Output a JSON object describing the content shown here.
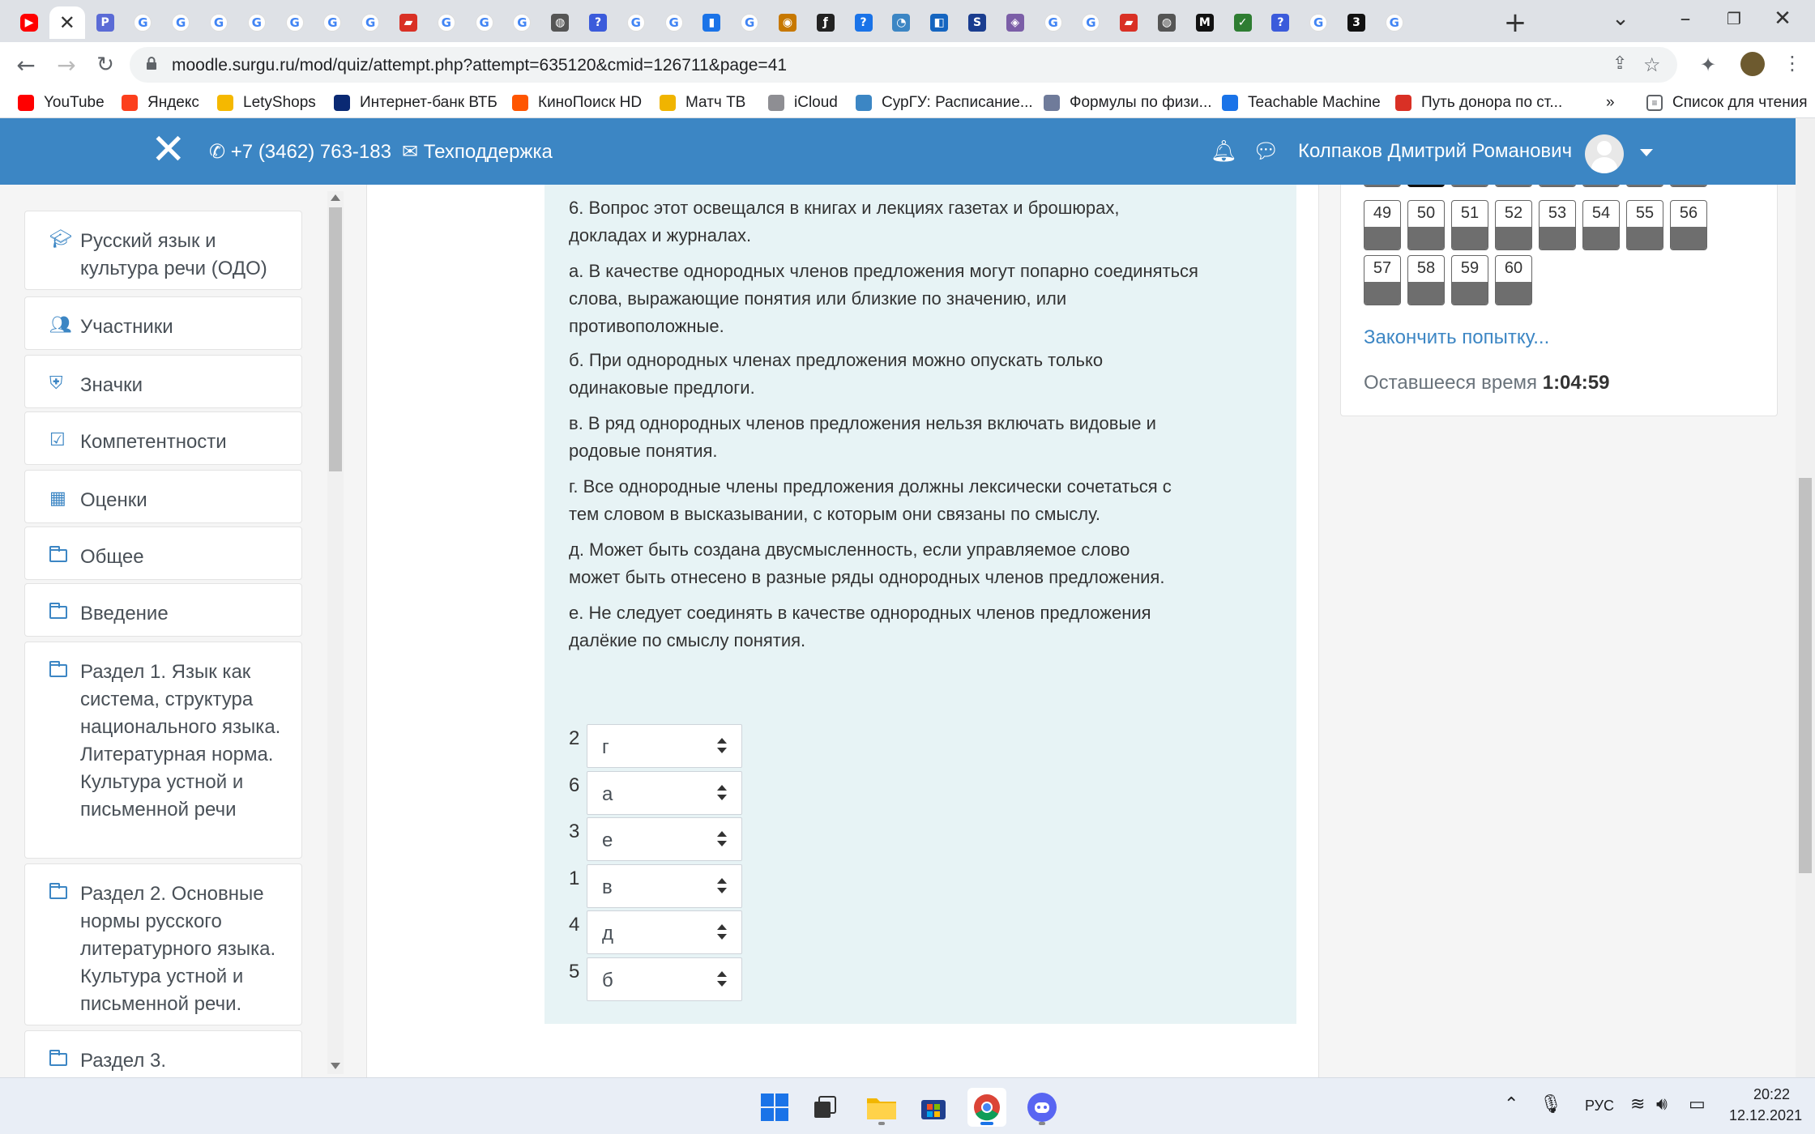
{
  "browser": {
    "url": "moodle.surgu.ru/mod/quiz/attempt.php?attempt=635120&cmid=126711&page=41",
    "bookmarks": [
      {
        "label": "YouTube",
        "color": "#ff0000"
      },
      {
        "label": "Яндекс",
        "color": "#fc3f1d"
      },
      {
        "label": "LetyShops",
        "color": "#f5b800"
      },
      {
        "label": "Интернет-банк ВТБ",
        "color": "#0a2973"
      },
      {
        "label": "КиноПоиск HD",
        "color": "#ff5500"
      },
      {
        "label": "Матч ТВ",
        "color": "#f0b400"
      },
      {
        "label": "iCloud",
        "color": "#8e8e93"
      },
      {
        "label": "СурГУ: Расписание...",
        "color": "#3c86c4"
      },
      {
        "label": "Формулы по физи...",
        "color": "#6f7b9a"
      },
      {
        "label": "Teachable Machine",
        "color": "#1a73e8"
      },
      {
        "label": "Путь донора по ст...",
        "color": "#d93025"
      }
    ],
    "more_bookmarks": "»",
    "reading_list": "Список для чтения"
  },
  "header": {
    "phone": "+7 (3462) 763-183",
    "support": "Техподдержка",
    "user_name": "Колпаков Дмитрий Романович"
  },
  "sidebar": {
    "items": [
      {
        "label": "Русский язык и культура речи (ОДО)",
        "icon": "graduation-cap-icon"
      },
      {
        "label": "Участники",
        "icon": "users-icon"
      },
      {
        "label": "Значки",
        "icon": "shield-icon"
      },
      {
        "label": "Компетентности",
        "icon": "checkbox-icon"
      },
      {
        "label": "Оценки",
        "icon": "table-icon"
      },
      {
        "label": "Общее",
        "icon": "folder-icon"
      },
      {
        "label": "Введение",
        "icon": "folder-icon"
      },
      {
        "label": "Раздел 1. Язык как система, структура национального языка. Литературная норма. Культура устной и письменной речи",
        "icon": "folder-icon"
      },
      {
        "label": "Раздел 2. Основные нормы русского литературного языка. Культура устной и письменной речи.",
        "icon": "folder-icon"
      },
      {
        "label": "Раздел 3.",
        "icon": "folder-icon"
      }
    ]
  },
  "question": {
    "lines": [
      "6. Вопрос этот освещался в книгах и лекциях газетах и брошюрах,",
      "докладах и журналах.",
      "а. В качестве однородных членов предложения могут попарно соединяться",
      "слова, выражающие понятия или близкие по значению, или",
      "противоположные.",
      "б. При однородных членах предложения можно опускать только",
      "одинаковые предлоги.",
      "в. В ряд однородных членов предложения нельзя включать видовые и",
      "родовые понятия.",
      "г. Все однородные члены предложения должны лексически сочетаться с",
      "тем словом в высказывании, с которым они связаны по смыслу.",
      "д. Может быть создана  двусмысленность,   если  управляемое слово",
      "может быть отнесено в разные ряды однородных членов предложения.",
      "е. Не следует соединять в качестве однородных членов предложения",
      "далёкие по смыслу понятия."
    ],
    "answers": [
      {
        "number": "2",
        "value": "г"
      },
      {
        "number": "6",
        "value": "а"
      },
      {
        "number": "3",
        "value": "е"
      },
      {
        "number": "1",
        "value": "в"
      },
      {
        "number": "4",
        "value": "д"
      },
      {
        "number": "5",
        "value": "б"
      }
    ]
  },
  "quiz_nav": {
    "buttons": [
      "49",
      "50",
      "51",
      "52",
      "53",
      "54",
      "55",
      "56",
      "57",
      "58",
      "59",
      "60"
    ],
    "finish_label": "Закончить попытку...",
    "time_label": "Оставшееся время",
    "time_value": "1:04:59"
  },
  "taskbar": {
    "lang": "РУС",
    "time": "20:22",
    "date": "12.12.2021"
  },
  "colors": {
    "brand": "#3c86c4",
    "question_bg": "#e7f3f5"
  }
}
